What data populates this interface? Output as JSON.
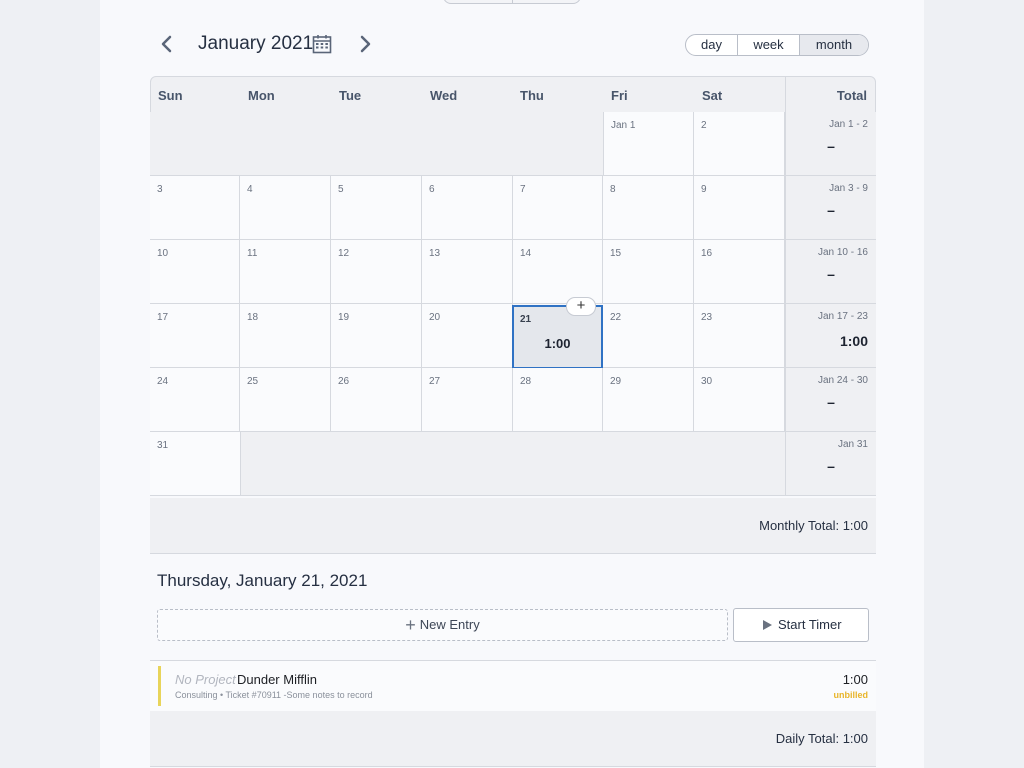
{
  "header": {
    "month_title": "January 2021",
    "views": [
      "day",
      "week",
      "month"
    ],
    "active_view": "month"
  },
  "calendar": {
    "weekdays": [
      "Sun",
      "Mon",
      "Tue",
      "Wed",
      "Thu",
      "Fri",
      "Sat"
    ],
    "total_label": "Total",
    "weeks": [
      {
        "days": [
          "",
          "",
          "",
          "",
          "",
          "Jan 1",
          "2"
        ],
        "range": "Jan 1 - 2",
        "total": "–"
      },
      {
        "days": [
          "3",
          "4",
          "5",
          "6",
          "7",
          "8",
          "9"
        ],
        "range": "Jan 3 - 9",
        "total": "–"
      },
      {
        "days": [
          "10",
          "11",
          "12",
          "13",
          "14",
          "15",
          "16"
        ],
        "range": "Jan 10 - 16",
        "total": "–"
      },
      {
        "days": [
          "17",
          "18",
          "19",
          "20",
          "21",
          "22",
          "23"
        ],
        "range": "Jan 17 - 23",
        "total": "1:00"
      },
      {
        "days": [
          "24",
          "25",
          "26",
          "27",
          "28",
          "29",
          "30"
        ],
        "range": "Jan 24 - 30",
        "total": "–"
      },
      {
        "days": [
          "31",
          "",
          "",
          "",
          "",
          "",
          ""
        ],
        "range": "Jan 31",
        "total": "–"
      }
    ],
    "selected_day": "21",
    "selected_hours": "1:00",
    "add_symbol": "+"
  },
  "monthly_total": "Monthly Total: 1:00",
  "day_detail": {
    "title": "Thursday, January 21, 2021",
    "new_entry_label": "New Entry",
    "start_timer_label": "Start Timer",
    "entries": [
      {
        "project": "No Project",
        "client": "Dunder Mifflin",
        "meta": "Consulting • Ticket #70911 -Some notes to record",
        "duration": "1:00",
        "status": "unbilled",
        "status_color": "#e8b52a"
      }
    ],
    "daily_total": "Daily Total: 1:00"
  },
  "colors": {
    "accent": "#2f72c4",
    "entry_bar": "#e8d45a"
  }
}
